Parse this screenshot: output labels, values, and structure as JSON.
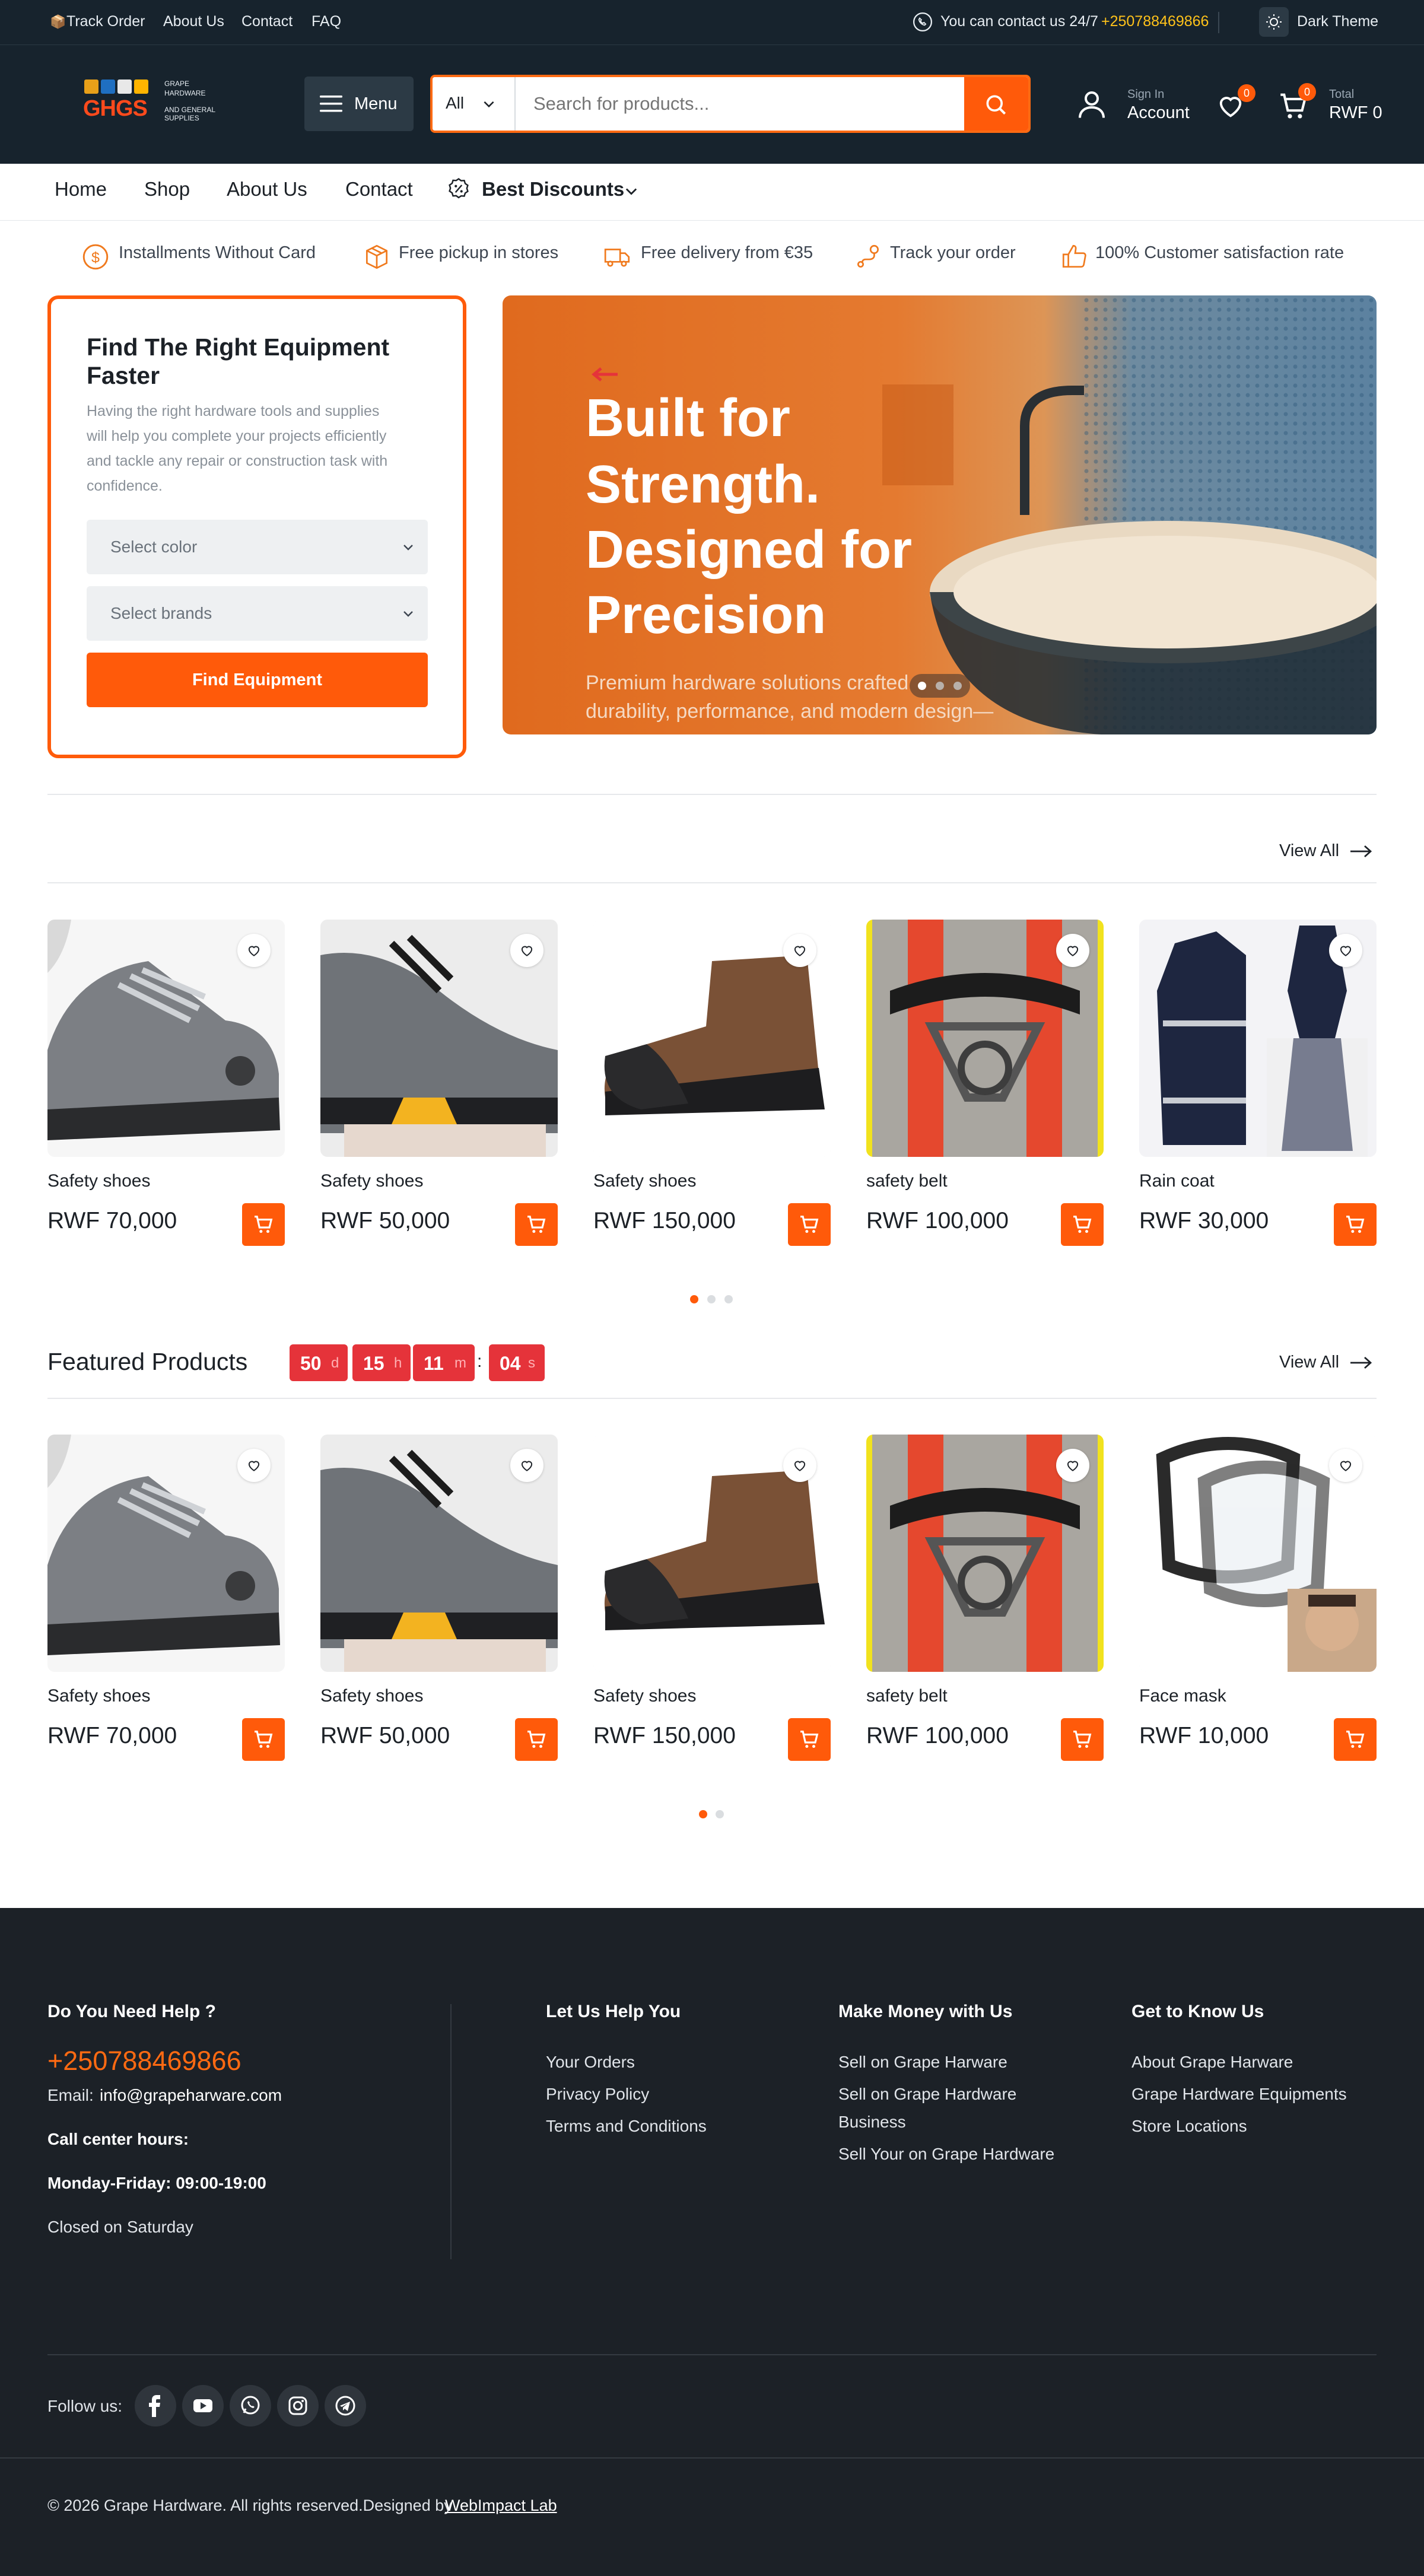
{
  "topbar": {
    "links": [
      "Track Order",
      "About Us",
      "Contact",
      "FAQ"
    ],
    "contact_text": "You can contact us 24/7",
    "phone": "+250788469866",
    "theme_label": "Dark Theme"
  },
  "header": {
    "logo": {
      "mark": "GHGS",
      "line1": "GRAPE",
      "line2": "HARDWARE",
      "line3": "AND GENERAL",
      "line4": "SUPPLIES"
    },
    "menu_label": "Menu",
    "search_category": "All",
    "search_placeholder": "Search for products...",
    "account_small": "Sign In",
    "account_label": "Account",
    "wishlist_count": "0",
    "cart_count": "0",
    "cart_small": "Total",
    "cart_total": "RWF 0"
  },
  "nav": {
    "items": [
      "Home",
      "Shop",
      "About Us",
      "Contact"
    ],
    "discounts": "Best Discounts"
  },
  "features": [
    {
      "icon": "dollar-coin-icon",
      "label": "Installments Without Card"
    },
    {
      "icon": "box-icon",
      "label": "Free pickup in stores"
    },
    {
      "icon": "truck-icon",
      "label": "Free delivery from €35"
    },
    {
      "icon": "route-icon",
      "label": "Track your order"
    },
    {
      "icon": "thumbs-up-icon",
      "label": "100% Customer satisfaction rate"
    }
  ],
  "finder": {
    "title_line1": "Find The Right Equipment",
    "title_line2": "Faster",
    "desc_lines": [
      "Having the right hardware tools and supplies",
      "will help you complete your projects efficiently",
      "and tackle any repair or construction task with",
      "confidence."
    ],
    "select_color": "Select color",
    "select_brands": "Select brands",
    "button": "Find Equipment"
  },
  "hero": {
    "lines": [
      "Built for",
      "Strength.",
      "Designed for",
      "Precision"
    ],
    "sub_line1": "Premium hardware solutions crafted",
    "sub_line2": "durability, performance, and modern design—"
  },
  "section1": {
    "view_all": "View All",
    "products": [
      {
        "name": "Safety shoes",
        "price": "RWF 70,000"
      },
      {
        "name": "Safety shoes",
        "price": "RWF 50,000"
      },
      {
        "name": "Safety shoes",
        "price": "RWF 150,000"
      },
      {
        "name": "safety belt",
        "price": "RWF 100,000"
      },
      {
        "name": "Rain coat",
        "price": "RWF 30,000"
      }
    ]
  },
  "featured": {
    "title": "Featured Products",
    "timer": [
      {
        "value": "50",
        "unit": "d"
      },
      {
        "value": "15",
        "unit": "h"
      },
      {
        "value": "11",
        "unit": "m"
      },
      {
        "value": "04",
        "unit": "s"
      }
    ],
    "timer_sep": ":",
    "view_all": "View All",
    "products": [
      {
        "name": "Safety shoes",
        "price": "RWF 70,000"
      },
      {
        "name": "Safety shoes",
        "price": "RWF 50,000"
      },
      {
        "name": "Safety shoes",
        "price": "RWF 150,000"
      },
      {
        "name": "safety belt",
        "price": "RWF 100,000"
      },
      {
        "name": "Face mask",
        "price": "RWF 10,000"
      }
    ]
  },
  "footer": {
    "help_title": "Do You Need Help ?",
    "phone": "+250788469866",
    "email_label": "Email:",
    "email": "info@grapeharware.com",
    "hours_title": "Call center hours:",
    "hours": "Monday-Friday: 09:00-19:00",
    "closed": "Closed on Saturday",
    "columns": [
      {
        "title": "Let Us Help You",
        "links": [
          "Your Orders",
          "Privacy Policy",
          "Terms and Conditions"
        ]
      },
      {
        "title": "Make Money with Us",
        "links": [
          "Sell on Grape Harware",
          "Sell on Grape Hardware",
          "Business",
          "Sell Your on Grape Hardware"
        ]
      },
      {
        "title": "Get to Know Us",
        "links": [
          "About Grape Harware",
          "Grape Hardware Equipments",
          "Store Locations"
        ]
      }
    ],
    "follow": "Follow us:",
    "social": [
      "facebook-icon",
      "youtube-icon",
      "whatsapp-icon",
      "instagram-icon",
      "telegram-icon"
    ],
    "copyright": "© 2026 Grape Hardware. All rights reserved.Designed by",
    "designer": "WebImpact Lab"
  },
  "colors": {
    "accent": "#ff5a0a",
    "dark": "#17232d",
    "footer": "#1c2127",
    "yellow": "#ffc21a",
    "timer": "#e5333a"
  }
}
